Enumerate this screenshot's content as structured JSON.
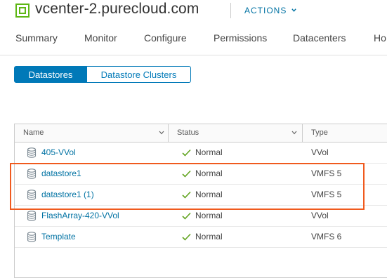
{
  "header": {
    "title": "vcenter-2.purecloud.com",
    "actions_label": "ACTIONS"
  },
  "nav": {
    "tabs": [
      "Summary",
      "Monitor",
      "Configure",
      "Permissions",
      "Datacenters",
      "Ho"
    ]
  },
  "toggle": {
    "active_label": "Datastores",
    "inactive_label": "Datastore Clusters"
  },
  "grid": {
    "columns": [
      "Name",
      "Status",
      "Type"
    ],
    "rows": [
      {
        "name": "405-VVol",
        "status": "Normal",
        "type": "VVol"
      },
      {
        "name": "datastore1",
        "status": "Normal",
        "type": "VMFS 5"
      },
      {
        "name": "datastore1 (1)",
        "status": "Normal",
        "type": "VMFS 5"
      },
      {
        "name": "FlashArray-420-VVol",
        "status": "Normal",
        "type": "VVol"
      },
      {
        "name": "Template",
        "status": "Normal",
        "type": "VMFS 6"
      }
    ]
  },
  "colors": {
    "accent": "#0079b8",
    "link": "#0072a3",
    "status_ok": "#62a420",
    "logo": "#5eb715",
    "highlight": "#f05a1e"
  }
}
